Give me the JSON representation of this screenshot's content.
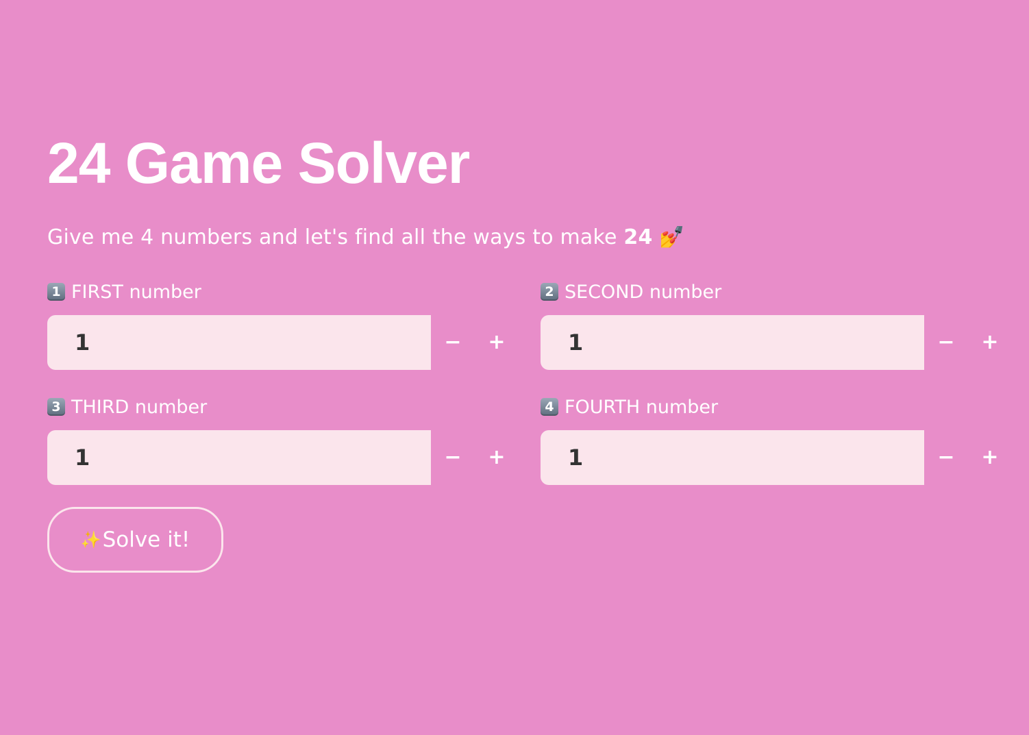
{
  "title": "24 Game Solver",
  "subtitle": {
    "text": "Give me 4 numbers and let's find all the ways to make ",
    "target": "24",
    "emoji": "💅"
  },
  "fields": [
    {
      "badge": "1",
      "label": "FIRST number",
      "value": "1",
      "minus": "−",
      "plus": "+"
    },
    {
      "badge": "2",
      "label": "SECOND number",
      "value": "1",
      "minus": "−",
      "plus": "+"
    },
    {
      "badge": "3",
      "label": "THIRD number",
      "value": "1",
      "minus": "−",
      "plus": "+"
    },
    {
      "badge": "4",
      "label": "FOURTH number",
      "value": "1",
      "minus": "−",
      "plus": "+"
    }
  ],
  "solve_button": {
    "icon": "✨",
    "label": "Solve it!"
  },
  "colors": {
    "background": "#e88dc9",
    "input_background": "#fbe5ec",
    "text": "#ffffff"
  }
}
